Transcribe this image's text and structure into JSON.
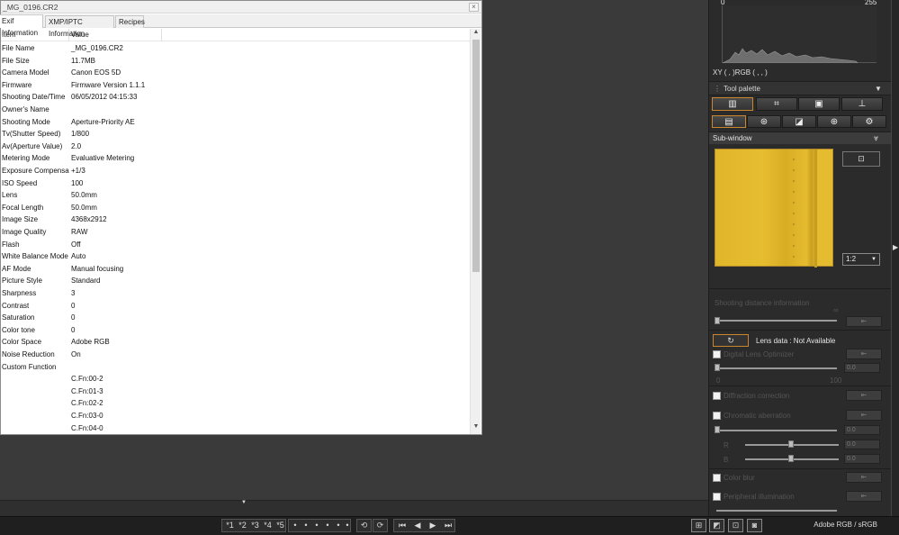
{
  "exif_window": {
    "title": "_MG_0196.CR2",
    "close": "×",
    "tabs": [
      "Exif Information",
      "XMP/IPTC Information",
      "Recipes"
    ],
    "columns": [
      "Item",
      "Value"
    ],
    "rows": [
      [
        "File Name",
        "_MG_0196.CR2"
      ],
      [
        "File Size",
        "11.7MB"
      ],
      [
        "Camera Model",
        "Canon EOS 5D"
      ],
      [
        "Firmware",
        "Firmware Version 1.1.1"
      ],
      [
        "Shooting Date/Time",
        "06/05/2012 04:15:33"
      ],
      [
        "Owner's Name",
        ""
      ],
      [
        "Shooting Mode",
        "Aperture-Priority AE"
      ],
      [
        "Tv(Shutter Speed)",
        "1/800"
      ],
      [
        "Av(Aperture Value)",
        "2.0"
      ],
      [
        "Metering Mode",
        "Evaluative Metering"
      ],
      [
        "Exposure Compensati...",
        "+1/3"
      ],
      [
        "ISO Speed",
        "100"
      ],
      [
        "Lens",
        "50.0mm"
      ],
      [
        "Focal Length",
        "50.0mm"
      ],
      [
        "Image Size",
        "4368x2912"
      ],
      [
        "Image Quality",
        "RAW"
      ],
      [
        "Flash",
        "Off"
      ],
      [
        "White Balance Mode",
        "Auto"
      ],
      [
        "AF Mode",
        "Manual focusing"
      ],
      [
        "Picture Style",
        "Standard"
      ],
      [
        "Sharpness",
        "3"
      ],
      [
        "Contrast",
        "0"
      ],
      [
        "Saturation",
        "0"
      ],
      [
        "Color tone",
        "0"
      ],
      [
        "Color Space",
        "Adobe RGB"
      ],
      [
        "Noise Reduction",
        "On"
      ],
      [
        "Custom Function",
        ""
      ],
      [
        "",
        "C.Fn:00-2"
      ],
      [
        "",
        "C.Fn:01-3"
      ],
      [
        "",
        "C.Fn:02-2"
      ],
      [
        "",
        "C.Fn:03-0"
      ],
      [
        "",
        "C.Fn:04-0"
      ]
    ]
  },
  "histogram": {
    "min_label": "0",
    "max_label": "255",
    "readout": "XY (    ,    )RGB (    ,    ,    )"
  },
  "tool_palette": {
    "label": "Tool palette",
    "tab_icons_row1": [
      "adjust-icon",
      "crop-icon",
      "stamp-icon",
      "export-icon"
    ],
    "tab_icons_row2": [
      "tone-icon",
      "nr-icon",
      "curve-icon",
      "color-icon",
      "settings-icon"
    ]
  },
  "subwindow": {
    "label": "Sub-window",
    "zoom": "1:2"
  },
  "lens": {
    "shooting_distance": "Shooting distance information",
    "infinity": "∞",
    "lens_data": "Lens data : Not Available",
    "digital_lens_optimizer": "Digital Lens Optimizer",
    "dlo_value": "0.0",
    "dlo_min": "0",
    "dlo_max": "100",
    "diffraction": "Diffraction correction",
    "chromatic": "Chromatic aberration",
    "chromatic_value": "0.0",
    "r_label": "R",
    "r_value": "0.0",
    "b_label": "B",
    "b_value": "0.0",
    "color_blur": "Color blur",
    "peripheral": "Peripheral illumination"
  },
  "bottom": {
    "ratings": [
      "*1",
      "*2",
      "*3",
      "*4",
      "*5"
    ],
    "dots": [
      "•",
      "•",
      "•",
      "•",
      "•",
      "•"
    ],
    "status": "Adobe RGB / sRGB"
  },
  "colors": {
    "accent": "#c9862f",
    "panel_bg": "#2b2b2b",
    "preview_yellow": "#e3b82d"
  }
}
